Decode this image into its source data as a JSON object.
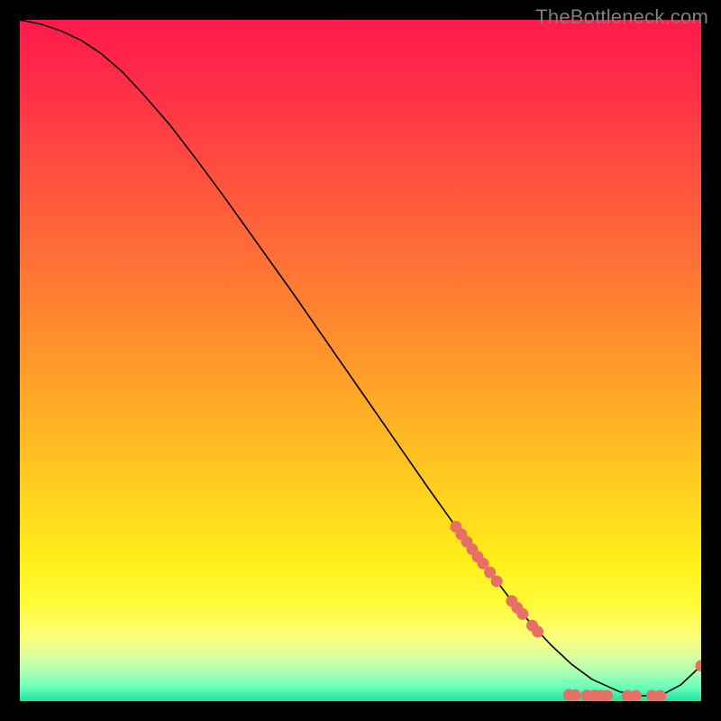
{
  "watermark": "TheBottleneck.com",
  "chart_data": {
    "type": "line",
    "title": "",
    "xlabel": "",
    "ylabel": "",
    "xlim": [
      0,
      100
    ],
    "ylim": [
      0,
      100
    ],
    "grid": false,
    "legend": false,
    "gradient_stops": [
      {
        "offset": 0.0,
        "color": "#ff1a4c"
      },
      {
        "offset": 0.1,
        "color": "#ff2e47"
      },
      {
        "offset": 0.22,
        "color": "#ff4e3f"
      },
      {
        "offset": 0.35,
        "color": "#ff7037"
      },
      {
        "offset": 0.48,
        "color": "#ff922d"
      },
      {
        "offset": 0.6,
        "color": "#ffb524"
      },
      {
        "offset": 0.72,
        "color": "#ffd81c"
      },
      {
        "offset": 0.8,
        "color": "#fff01a"
      },
      {
        "offset": 0.86,
        "color": "#fffb3a"
      },
      {
        "offset": 0.905,
        "color": "#fcff7a"
      },
      {
        "offset": 0.935,
        "color": "#d8ffa0"
      },
      {
        "offset": 0.96,
        "color": "#a4ffb4"
      },
      {
        "offset": 0.98,
        "color": "#66ffba"
      },
      {
        "offset": 1.0,
        "color": "#22e0a0"
      }
    ],
    "series": [
      {
        "name": "curve",
        "color": "#000000",
        "x": [
          0.0,
          3.0,
          6.0,
          9.0,
          12.0,
          15.0,
          18.0,
          22.0,
          26.0,
          30.0,
          35.0,
          40.0,
          45.0,
          50.0,
          55.0,
          60.0,
          64.0,
          68.0,
          72.0,
          75.0,
          78.0,
          81.0,
          84.0,
          88.0,
          91.0,
          94.0,
          97.0,
          100.0
        ],
        "y": [
          100.0,
          99.4,
          98.4,
          97.0,
          95.0,
          92.4,
          89.2,
          84.6,
          79.4,
          74.0,
          67.0,
          60.0,
          52.8,
          45.6,
          38.4,
          31.2,
          25.6,
          20.2,
          15.0,
          11.4,
          8.2,
          5.4,
          3.2,
          1.4,
          0.8,
          0.8,
          2.4,
          5.2
        ]
      }
    ],
    "markers": {
      "name": "dots",
      "color": "#e67066",
      "radius_px": 6.5,
      "points": [
        {
          "x": 64.0,
          "y": 25.6
        },
        {
          "x": 64.8,
          "y": 24.5
        },
        {
          "x": 65.6,
          "y": 23.4
        },
        {
          "x": 66.4,
          "y": 22.3
        },
        {
          "x": 67.2,
          "y": 21.2
        },
        {
          "x": 68.0,
          "y": 20.2
        },
        {
          "x": 69.0,
          "y": 18.9
        },
        {
          "x": 70.0,
          "y": 17.6
        },
        {
          "x": 72.2,
          "y": 14.7
        },
        {
          "x": 73.0,
          "y": 13.7
        },
        {
          "x": 73.8,
          "y": 12.8
        },
        {
          "x": 75.2,
          "y": 11.1
        },
        {
          "x": 76.0,
          "y": 10.2
        },
        {
          "x": 80.6,
          "y": 0.95
        },
        {
          "x": 81.5,
          "y": 0.9
        },
        {
          "x": 83.2,
          "y": 0.85
        },
        {
          "x": 84.3,
          "y": 0.82
        },
        {
          "x": 85.2,
          "y": 0.8
        },
        {
          "x": 86.2,
          "y": 0.8
        },
        {
          "x": 89.2,
          "y": 0.8
        },
        {
          "x": 90.4,
          "y": 0.8
        },
        {
          "x": 92.8,
          "y": 0.8
        },
        {
          "x": 94.0,
          "y": 0.8
        },
        {
          "x": 100.0,
          "y": 5.2
        }
      ]
    }
  }
}
